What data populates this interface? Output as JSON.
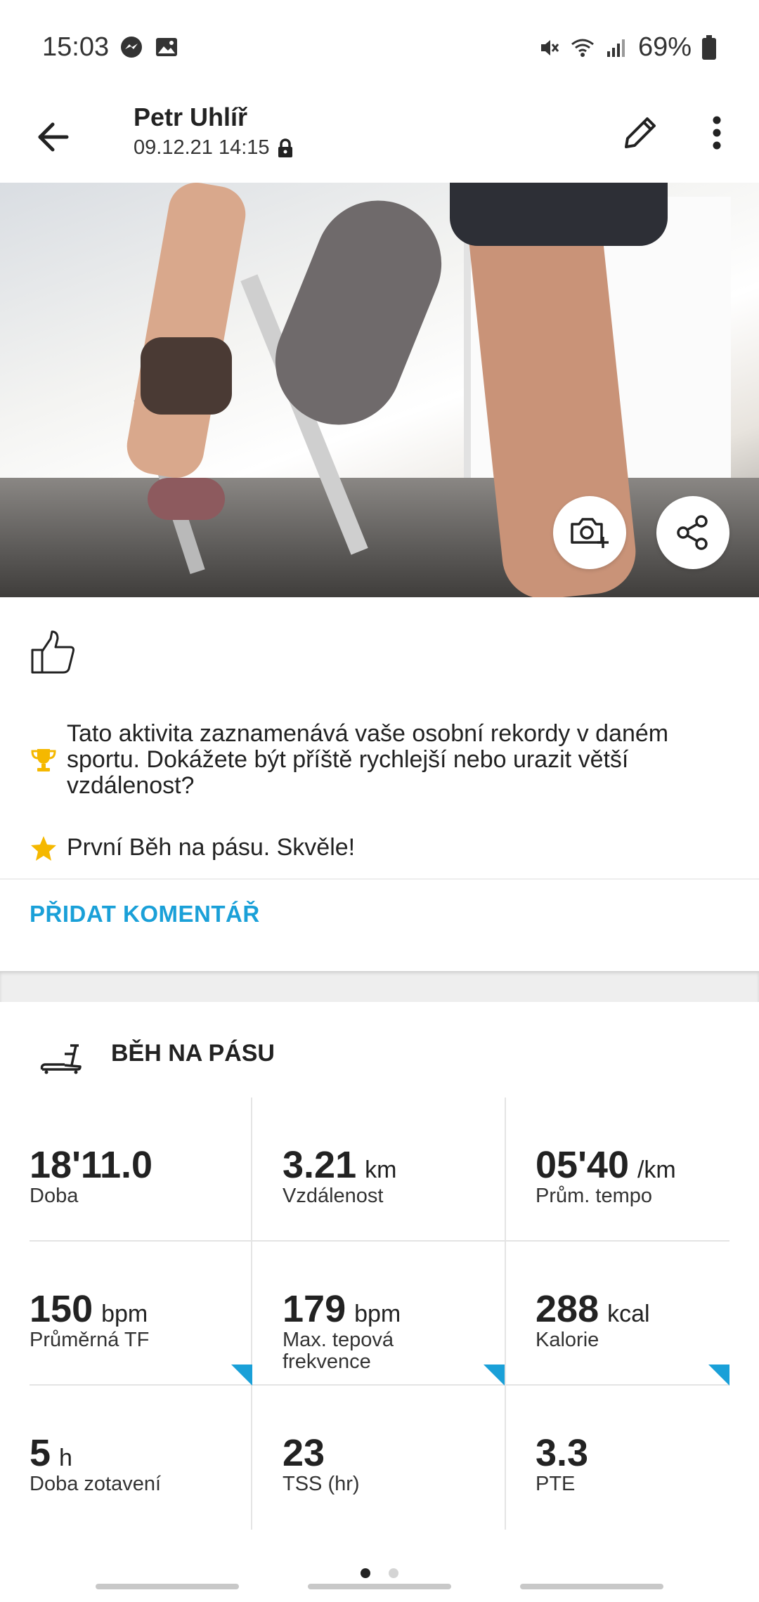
{
  "status_bar": {
    "time": "15:03",
    "battery": "69%"
  },
  "header": {
    "user_name": "Petr Uhlíř",
    "date": "09.12.21 14:15"
  },
  "feed": {
    "achievements": [
      {
        "icon": "trophy-icon",
        "text": "Tato aktivita zaznamenává vaše osobní rekordy v daném sportu. Dokážete být příště rychlejší nebo urazit větší vzdálenost?"
      },
      {
        "icon": "star-icon",
        "text": "První Běh na pásu. Skvěle!"
      }
    ],
    "add_comment_label": "PŘIDAT KOMENTÁŘ"
  },
  "activity": {
    "title": "BĚH NA PÁSU",
    "stats": [
      {
        "value": "18'11.0",
        "unit": "",
        "label": "Doba"
      },
      {
        "value": "3.21",
        "unit": "km",
        "label": "Vzdálenost"
      },
      {
        "value": "05'40",
        "unit": "/km",
        "label": "Prům. tempo"
      },
      {
        "value": "150",
        "unit": "bpm",
        "label": "Průměrná TF"
      },
      {
        "value": "179",
        "unit": "bpm",
        "label": "Max. tepová frekvence"
      },
      {
        "value": "288",
        "unit": "kcal",
        "label": "Kalorie"
      },
      {
        "value": "5",
        "unit": "h",
        "label": "Doba zotavení"
      },
      {
        "value": "23",
        "unit": "",
        "label": "TSS (hr)"
      },
      {
        "value": "3.3",
        "unit": "",
        "label": "PTE"
      }
    ]
  },
  "colors": {
    "accent": "#1aa0d8",
    "trophy": "#f5b800",
    "star": "#f5b800"
  },
  "pager": {
    "pages": 2,
    "current": 1
  }
}
